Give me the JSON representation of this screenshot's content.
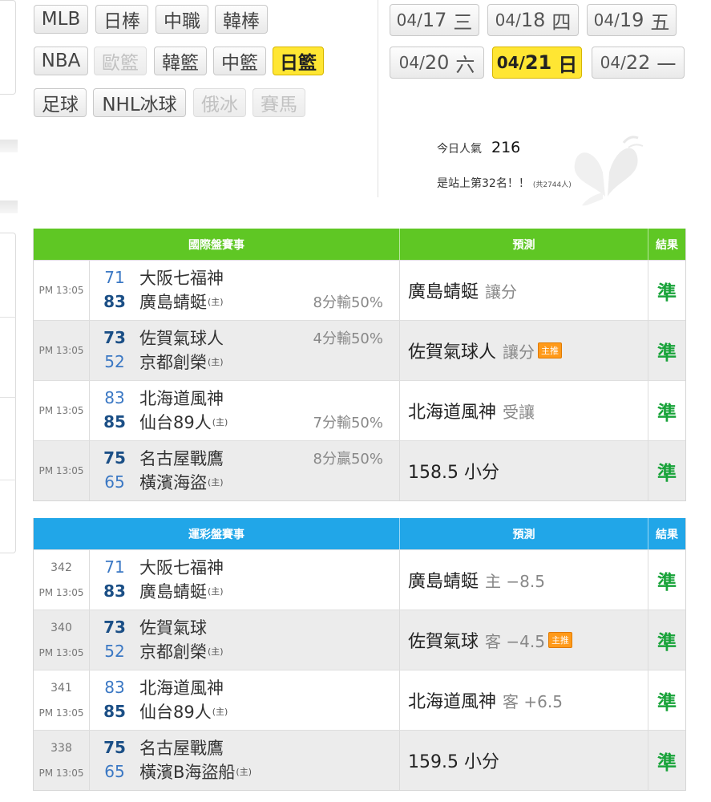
{
  "sports": [
    {
      "label": "MLB",
      "state": "normal"
    },
    {
      "label": "日棒",
      "state": "normal"
    },
    {
      "label": "中職",
      "state": "normal"
    },
    {
      "label": "韓棒",
      "state": "normal"
    },
    {
      "label": "NBA",
      "state": "normal"
    },
    {
      "label": "歐籃",
      "state": "disabled"
    },
    {
      "label": "韓籃",
      "state": "normal"
    },
    {
      "label": "中籃",
      "state": "normal"
    },
    {
      "label": "日籃",
      "state": "active"
    },
    {
      "label": "足球",
      "state": "normal"
    },
    {
      "label": "NHL冰球",
      "state": "normal"
    },
    {
      "label": "俄冰",
      "state": "disabled"
    },
    {
      "label": "賽馬",
      "state": "disabled"
    }
  ],
  "dates": [
    {
      "md": "04/",
      "d": "17",
      "wk": "三",
      "active": false
    },
    {
      "md": "04/",
      "d": "18",
      "wk": "四",
      "active": false
    },
    {
      "md": "04/",
      "d": "19",
      "wk": "五",
      "active": false
    },
    {
      "md": "04/",
      "d": "20",
      "wk": "六",
      "active": false
    },
    {
      "md": "04/",
      "d": "21",
      "wk": "日",
      "active": true
    },
    {
      "md": "04/",
      "d": "22",
      "wk": "一",
      "active": false
    }
  ],
  "popularity": {
    "label": "今日人氣",
    "count": "216",
    "rank_text": "是站上第32名！！",
    "total_text": "(共2744人)"
  },
  "colors": {
    "international_header": "#5fc724",
    "lottery_header": "#21a6e8",
    "active_button": "#ffe633",
    "result_correct": "#19a33a"
  },
  "international": {
    "header": {
      "match": "國際盤賽事",
      "prediction": "預測",
      "result": "結果"
    },
    "rows": [
      {
        "time": "PM 13:05",
        "team1": {
          "score": "71",
          "name": "大阪七福神",
          "home": "",
          "win": false
        },
        "team2": {
          "score": "83",
          "name": "廣島蜻蜓",
          "home": "(主)",
          "win": true
        },
        "spread": "8分輸50%",
        "spread_line": 2,
        "pred_main": "廣島蜻蜓",
        "pred_sub": "讓分",
        "badge": "",
        "result": "準"
      },
      {
        "time": "PM 13:05",
        "team1": {
          "score": "73",
          "name": "佐賀氣球人",
          "home": "",
          "win": true
        },
        "team2": {
          "score": "52",
          "name": "京都創榮",
          "home": "(主)",
          "win": false
        },
        "spread": "4分輸50%",
        "spread_line": 1,
        "pred_main": "佐賀氣球人",
        "pred_sub": "讓分",
        "badge": "主推",
        "result": "準"
      },
      {
        "time": "PM 13:05",
        "team1": {
          "score": "83",
          "name": "北海道風神",
          "home": "",
          "win": false
        },
        "team2": {
          "score": "85",
          "name": "仙台89人",
          "home": "(主)",
          "win": true
        },
        "spread": "7分輸50%",
        "spread_line": 2,
        "pred_main": "北海道風神",
        "pred_sub": "受讓",
        "badge": "",
        "result": "準"
      },
      {
        "time": "PM 13:05",
        "team1": {
          "score": "75",
          "name": "名古屋戰鷹",
          "home": "",
          "win": true
        },
        "team2": {
          "score": "65",
          "name": "橫濱海盜",
          "home": "(主)",
          "win": false
        },
        "spread": "8分贏50%",
        "spread_line": 1,
        "pred_main": "158.5 小分",
        "pred_sub": "",
        "badge": "",
        "result": "準"
      }
    ]
  },
  "lottery": {
    "header": {
      "match": "運彩盤賽事",
      "prediction": "預測",
      "result": "結果"
    },
    "rows": [
      {
        "num": "342",
        "time": "PM 13:05",
        "team1": {
          "score": "71",
          "name": "大阪七福神",
          "home": "",
          "win": false
        },
        "team2": {
          "score": "83",
          "name": "廣島蜻蜓",
          "home": "(主)",
          "win": true
        },
        "pred_main": "廣島蜻蜓",
        "pred_sub": "主 −8.5",
        "badge": "",
        "result": "準"
      },
      {
        "num": "340",
        "time": "PM 13:05",
        "team1": {
          "score": "73",
          "name": "佐賀氣球",
          "home": "",
          "win": true
        },
        "team2": {
          "score": "52",
          "name": "京都創榮",
          "home": "(主)",
          "win": false
        },
        "pred_main": "佐賀氣球",
        "pred_sub": "客 −4.5",
        "badge": "主推",
        "result": "準"
      },
      {
        "num": "341",
        "time": "PM 13:05",
        "team1": {
          "score": "83",
          "name": "北海道風神",
          "home": "",
          "win": false
        },
        "team2": {
          "score": "85",
          "name": "仙台89人",
          "home": "(主)",
          "win": true
        },
        "pred_main": "北海道風神",
        "pred_sub": "客 +6.5",
        "badge": "",
        "result": "準"
      },
      {
        "num": "338",
        "time": "PM 13:05",
        "team1": {
          "score": "75",
          "name": "名古屋戰鷹",
          "home": "",
          "win": true
        },
        "team2": {
          "score": "65",
          "name": "橫濱B海盜船",
          "home": "(主)",
          "win": false
        },
        "pred_main": "159.5 小分",
        "pred_sub": "",
        "badge": "",
        "result": "準"
      }
    ]
  }
}
